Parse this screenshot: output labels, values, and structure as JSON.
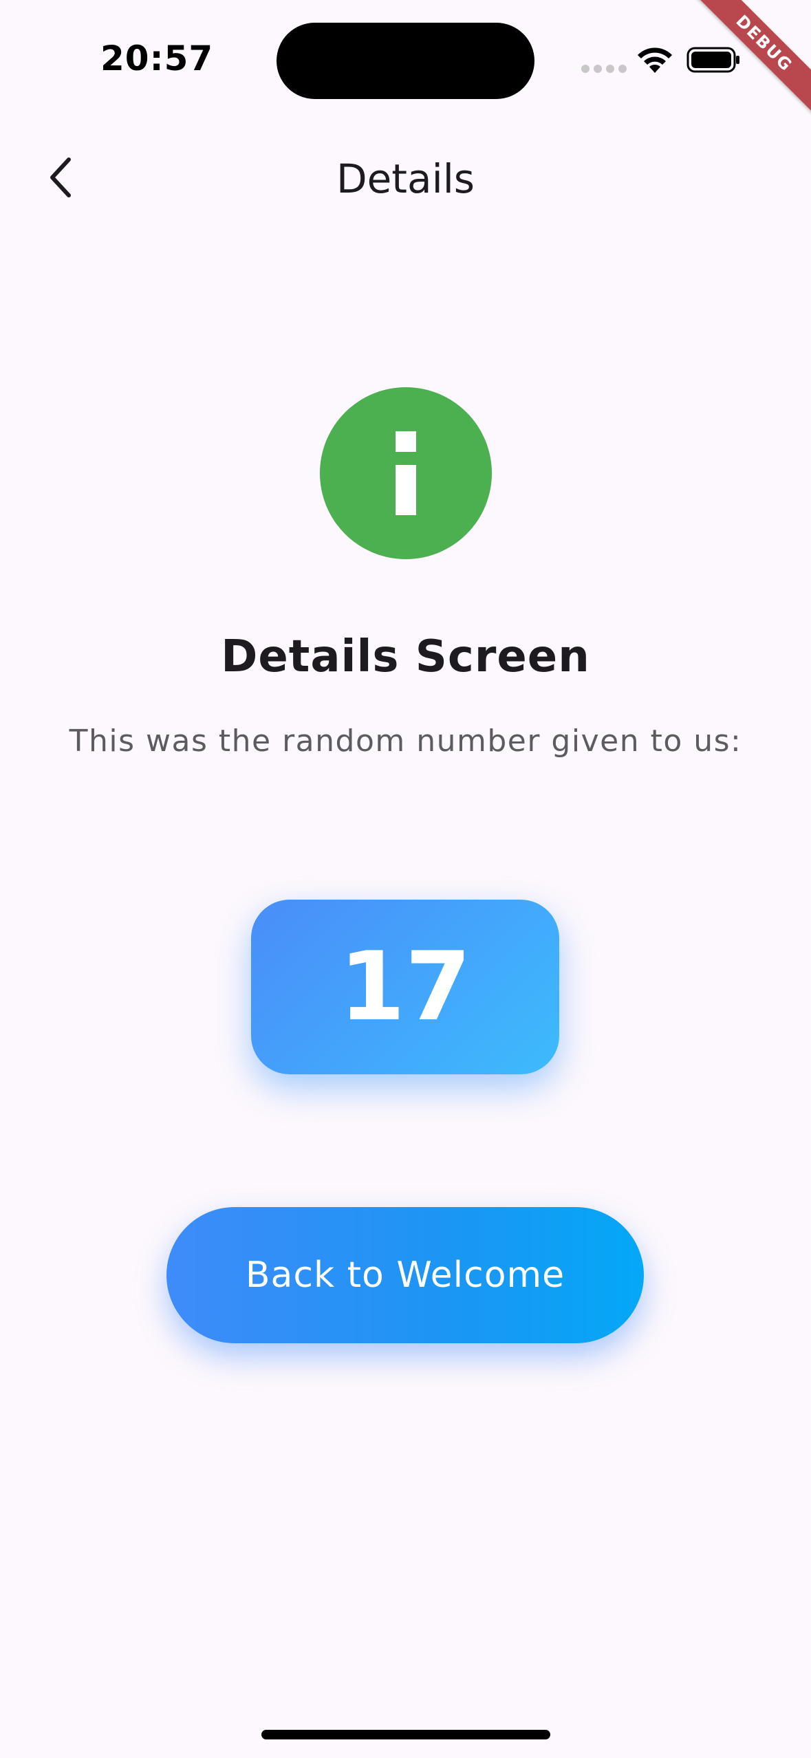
{
  "status_bar": {
    "time": "20:57"
  },
  "debug_banner": "DEBUG",
  "app_bar": {
    "title": "Details",
    "back_icon": "chevron-left-icon"
  },
  "content": {
    "icon": "info-icon",
    "icon_color": "#4caf50",
    "heading": "Details Screen",
    "subtitle": "This was the random number given to us:",
    "number": "17",
    "button_label": "Back to Welcome"
  },
  "colors": {
    "background": "#fdf8fd",
    "accent_gradient_start": "#4a8df9",
    "accent_gradient_end": "#3dbbfd"
  }
}
